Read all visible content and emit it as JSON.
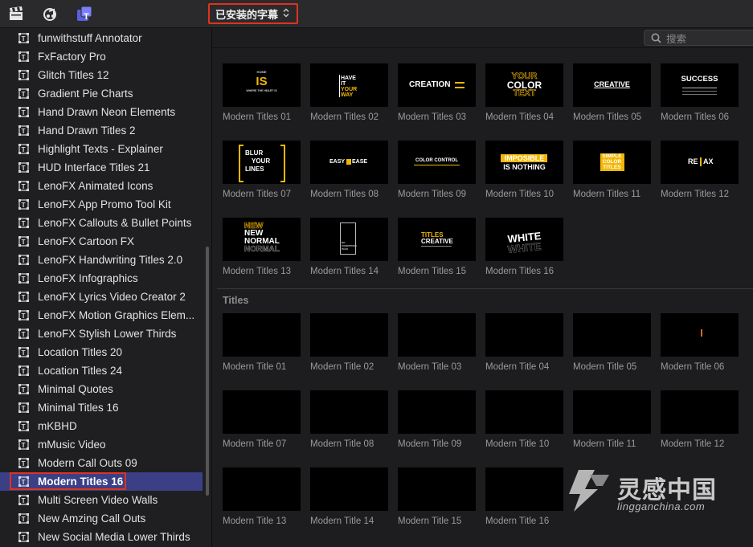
{
  "toolbar": {
    "icons": [
      "clapperboard-icon",
      "music-photo-icon",
      "titles-generators-icon"
    ],
    "dropdown_label": "已安装的字幕",
    "dropdown_chevron": "⌃⌄"
  },
  "search": {
    "placeholder": "搜索"
  },
  "sidebar": {
    "items": [
      {
        "label": "funwithstuff Annotator"
      },
      {
        "label": "FxFactory Pro"
      },
      {
        "label": "Glitch Titles 12"
      },
      {
        "label": "Gradient Pie Charts"
      },
      {
        "label": "Hand Drawn Neon Elements"
      },
      {
        "label": "Hand Drawn Titles 2"
      },
      {
        "label": "Highlight Texts - Explainer"
      },
      {
        "label": "HUD Interface Titles 21"
      },
      {
        "label": "LenoFX Animated Icons"
      },
      {
        "label": "LenoFX App Promo Tool Kit"
      },
      {
        "label": "LenoFX Callouts & Bullet Points"
      },
      {
        "label": "LenoFX Cartoon FX"
      },
      {
        "label": "LenoFX Handwriting Titles 2.0"
      },
      {
        "label": "LenoFX Infographics"
      },
      {
        "label": "LenoFX Lyrics Video Creator 2"
      },
      {
        "label": "LenoFX Motion Graphics Elem..."
      },
      {
        "label": "LenoFX Stylish Lower Thirds"
      },
      {
        "label": "Location Titles 20"
      },
      {
        "label": "Location Titles 24"
      },
      {
        "label": "Minimal Quotes"
      },
      {
        "label": "Minimal Titles 16"
      },
      {
        "label": "mKBHD"
      },
      {
        "label": "mMusic Video"
      },
      {
        "label": "Modern Call Outs 09"
      },
      {
        "label": "Modern Titles 16",
        "selected": true
      },
      {
        "label": "Multi Screen Video Walls"
      },
      {
        "label": "New Amzing Call Outs"
      },
      {
        "label": "New Social Media Lower Thirds"
      }
    ]
  },
  "modern_titles": [
    {
      "caption": "Modern Titles 01",
      "thumb": [
        "HOME",
        "IS",
        "WHERE THE HEART IS"
      ]
    },
    {
      "caption": "Modern Titles 02",
      "thumb": [
        "HAVE",
        "IT",
        "YOUR",
        "WAY"
      ]
    },
    {
      "caption": "Modern Titles 03",
      "thumb": [
        "CREATION"
      ]
    },
    {
      "caption": "Modern Titles 04",
      "thumb": [
        "YOUR",
        "COLOR",
        "TEXT"
      ]
    },
    {
      "caption": "Modern Titles 05",
      "thumb": [
        "CREATIVE"
      ]
    },
    {
      "caption": "Modern Titles 06",
      "thumb": [
        "SUCCESS"
      ]
    },
    {
      "caption": "Modern Titles 07",
      "thumb": [
        "BLUR",
        "YOUR",
        "LINES"
      ]
    },
    {
      "caption": "Modern Titles 08",
      "thumb": [
        "EASY",
        "EASE"
      ]
    },
    {
      "caption": "Modern Titles 09",
      "thumb": [
        "COLOR CONTROL"
      ]
    },
    {
      "caption": "Modern Titles 10",
      "thumb": [
        "IMPOSIBLE",
        "IS NOTHING"
      ]
    },
    {
      "caption": "Modern Titles 11",
      "thumb": [
        "SIMPLE",
        "COLOR",
        "TITLES"
      ]
    },
    {
      "caption": "Modern Titles 12",
      "thumb": [
        "RE",
        "AX"
      ]
    },
    {
      "caption": "Modern Titles 13",
      "thumb": [
        "NEW",
        "NEW",
        "NORMAL",
        "NORMAL"
      ]
    },
    {
      "caption": "Modern Titles 14",
      "thumb": [
        "NO",
        "CONDITIONS",
        "PACK"
      ]
    },
    {
      "caption": "Modern Titles 15",
      "thumb": [
        "TITLES",
        "CREATIVE"
      ]
    },
    {
      "caption": "Modern Titles 16",
      "thumb": [
        "WHITE",
        "WHITE"
      ]
    }
  ],
  "section_label": "Titles",
  "titles": [
    {
      "caption": "Modern Title 01"
    },
    {
      "caption": "Modern Title 02"
    },
    {
      "caption": "Modern Title 03"
    },
    {
      "caption": "Modern Title 04"
    },
    {
      "caption": "Modern Title 05"
    },
    {
      "caption": "Modern Title 06"
    },
    {
      "caption": "Modern Title 07"
    },
    {
      "caption": "Modern Title 08"
    },
    {
      "caption": "Modern Title 09"
    },
    {
      "caption": "Modern Title 10"
    },
    {
      "caption": "Modern Title 11"
    },
    {
      "caption": "Modern Title 12"
    },
    {
      "caption": "Modern Title 13"
    },
    {
      "caption": "Modern Title 14"
    },
    {
      "caption": "Modern Title 15"
    },
    {
      "caption": "Modern Title 16"
    }
  ],
  "watermark": {
    "brand": "灵感中国",
    "url": "lingganchina.com"
  },
  "colors": {
    "highlight_red": "#e0321f",
    "selection": "#3a3f86",
    "accent_yellow": "#f2b705"
  }
}
